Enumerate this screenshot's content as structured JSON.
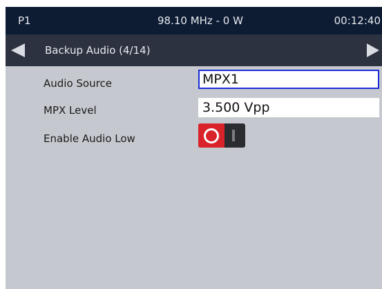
{
  "status": {
    "profile": "P1",
    "frequency_power": "98.10 MHz - 0 W",
    "time": "00:12:40"
  },
  "nav": {
    "title": "Backup Audio (4/14)",
    "prev_icon": "left-arrow-icon",
    "next_icon": "right-arrow-icon"
  },
  "settings": {
    "audio_source": {
      "label": "Audio Source",
      "value": "MPX1"
    },
    "mpx_level": {
      "label": "MPX Level",
      "value": "3.500 Vpp"
    },
    "enable_audio_low": {
      "label": "Enable Audio Low",
      "state": "off"
    }
  },
  "colors": {
    "status_bg": "#0d1b33",
    "nav_bg": "#2d3240",
    "content_bg": "#c5c8ce",
    "selection_border": "#1a2bd6",
    "toggle_off": "#d8232a"
  }
}
